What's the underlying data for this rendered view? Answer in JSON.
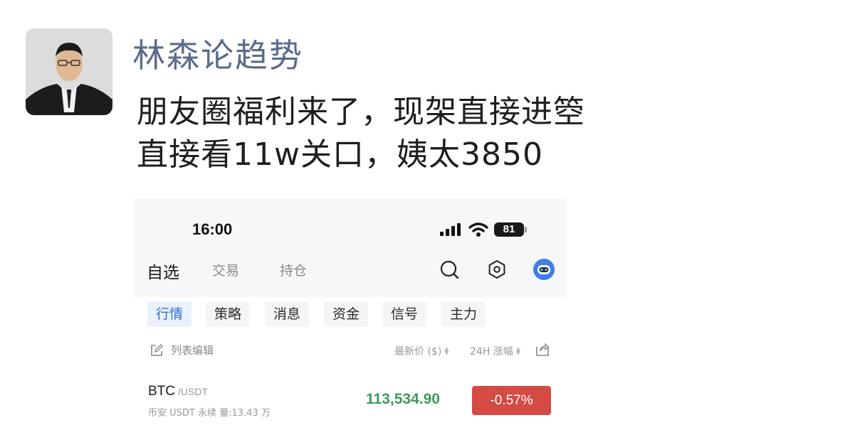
{
  "post": {
    "author": "林森论趋势",
    "lines": [
      "朋友圈福利来了，现架直接进箜",
      "直接看11w关口，姨太3850"
    ]
  },
  "screenshot": {
    "status_bar": {
      "time": "16:00",
      "battery": "81"
    },
    "tabs": [
      {
        "label": "自选",
        "active": true
      },
      {
        "label": "交易",
        "active": false
      },
      {
        "label": "持仓",
        "active": false
      }
    ],
    "header_icons": [
      "search-icon",
      "hexagon-settings-icon",
      "robot-assistant-icon"
    ],
    "sub_tabs": [
      {
        "label": "行情",
        "active": true
      },
      {
        "label": "策略",
        "active": false
      },
      {
        "label": "消息",
        "active": false
      },
      {
        "label": "资金",
        "active": false
      },
      {
        "label": "信号",
        "active": false
      },
      {
        "label": "主力",
        "active": false
      }
    ],
    "list_edit_label": "列表编辑",
    "columns": {
      "price": "最新价 ($)",
      "change": "24H 涨幅"
    },
    "rows": [
      {
        "symbol": "BTC",
        "pair": "/USDT",
        "subtitle": "币安 USDT 永续  量:13.43 万",
        "price": "113,534.90",
        "change": "-0.57%"
      }
    ],
    "colors": {
      "up_green": "#3d9a5a",
      "down_red": "#d54a43",
      "accent_blue": "#2d6fd6",
      "author_color": "#5a6b8c"
    }
  }
}
